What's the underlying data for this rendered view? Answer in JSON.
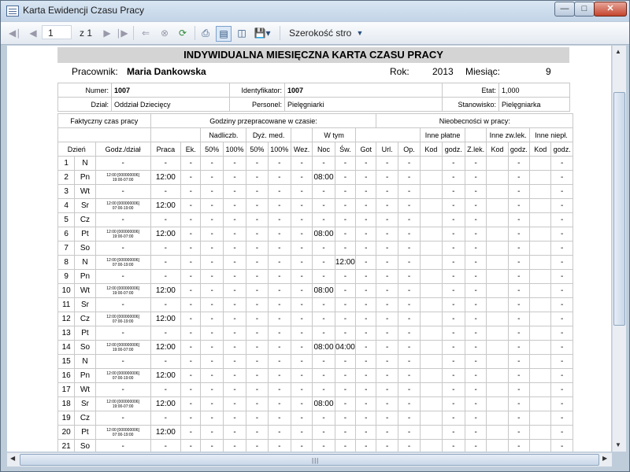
{
  "window": {
    "title": "Karta Ewidencji Czasu Pracy"
  },
  "toolbar": {
    "page_current": "1",
    "page_of": "z 1",
    "zoom_mode": "Szerokość stro"
  },
  "doc": {
    "title": "INDYWIDUALNA MIESIĘCZNA KARTA CZASU PRACY",
    "employee_label": "Pracownik:",
    "employee": "Maria Dankowska",
    "year_label": "Rok:",
    "year": "2013",
    "month_label": "Miesiąc:",
    "month": "9",
    "info": {
      "numer_label": "Numer:",
      "numer": "1007",
      "identyfikator_label": "Identyfikator:",
      "identyfikator": "1007",
      "etat_label": "Etat:",
      "etat": "1,000",
      "dzial_label": "Dział:",
      "dzial": "Oddział Dziecięcy",
      "personel_label": "Personel:",
      "personel": "Pielęgniarki",
      "stanowisko_label": "Stanowisko:",
      "stanowisko": "Pielęgniarka"
    },
    "headers": {
      "faktyczny": "Faktyczny czas pracy",
      "godziny": "Godziny przepracowane w czasie:",
      "nieobecnosci": "Nieobecności w pracy:",
      "nadliczb": "Nadliczb.",
      "dyz_med": "Dyż. med.",
      "w_tym": "W tym",
      "inne_platne": "Inne płatne",
      "inne_zw_lek": "Inne zw.lek.",
      "inne_niepl": "Inne niepł.",
      "cols": [
        "Dzień",
        "Godz./dział",
        "Praca",
        "Ek.",
        "50%",
        "100%",
        "50%",
        "100%",
        "Wez.",
        "Noc",
        "Św.",
        "Got",
        "Url.",
        "Op.",
        "Kod",
        "godz.",
        "Z.lek.",
        "Kod",
        "godz.",
        "Kod",
        "godz."
      ]
    },
    "rows": [
      {
        "day": "1",
        "dow": "N",
        "gd": "-",
        "praca": "-",
        "noc": "-",
        "sw": "-"
      },
      {
        "day": "2",
        "dow": "Pn",
        "gd": "12:00 [000000006]\n19:00-07:00",
        "praca": "12:00",
        "noc": "08:00",
        "sw": "-"
      },
      {
        "day": "3",
        "dow": "Wt",
        "gd": "-",
        "praca": "-",
        "noc": "-",
        "sw": "-"
      },
      {
        "day": "4",
        "dow": "Sr",
        "gd": "12:00 [000000006]\n07:00-19:00",
        "praca": "12:00",
        "noc": "-",
        "sw": "-"
      },
      {
        "day": "5",
        "dow": "Cz",
        "gd": "-",
        "praca": "-",
        "noc": "-",
        "sw": "-"
      },
      {
        "day": "6",
        "dow": "Pt",
        "gd": "12:00 [000000006]\n19:00-07:00",
        "praca": "12:00",
        "noc": "08:00",
        "sw": "-"
      },
      {
        "day": "7",
        "dow": "So",
        "gd": "-",
        "praca": "-",
        "noc": "-",
        "sw": "-"
      },
      {
        "day": "8",
        "dow": "N",
        "gd": "12:00 [000000006]\n07:00-19:00",
        "praca": "-",
        "noc": "-",
        "sw": "12:00"
      },
      {
        "day": "9",
        "dow": "Pn",
        "gd": "-",
        "praca": "-",
        "noc": "-",
        "sw": "-"
      },
      {
        "day": "10",
        "dow": "Wt",
        "gd": "12:00 [000000006]\n19:00-07:00",
        "praca": "12:00",
        "noc": "08:00",
        "sw": "-"
      },
      {
        "day": "11",
        "dow": "Sr",
        "gd": "-",
        "praca": "-",
        "noc": "-",
        "sw": "-"
      },
      {
        "day": "12",
        "dow": "Cz",
        "gd": "12:00 [000000006]\n07:00-19:00",
        "praca": "12:00",
        "noc": "-",
        "sw": "-"
      },
      {
        "day": "13",
        "dow": "Pt",
        "gd": "-",
        "praca": "-",
        "noc": "-",
        "sw": "-"
      },
      {
        "day": "14",
        "dow": "So",
        "gd": "12:00 [000000006]\n19:00-07:00",
        "praca": "12:00",
        "noc": "08:00",
        "sw": "04:00"
      },
      {
        "day": "15",
        "dow": "N",
        "gd": "-",
        "praca": "-",
        "noc": "-",
        "sw": "-"
      },
      {
        "day": "16",
        "dow": "Pn",
        "gd": "12:00 [000000006]\n07:00-19:00",
        "praca": "12:00",
        "noc": "-",
        "sw": "-"
      },
      {
        "day": "17",
        "dow": "Wt",
        "gd": "-",
        "praca": "-",
        "noc": "-",
        "sw": "-"
      },
      {
        "day": "18",
        "dow": "Sr",
        "gd": "12:00 [000000006]\n19:00-07:00",
        "praca": "12:00",
        "noc": "08:00",
        "sw": "-"
      },
      {
        "day": "19",
        "dow": "Cz",
        "gd": "-",
        "praca": "-",
        "noc": "-",
        "sw": "-"
      },
      {
        "day": "20",
        "dow": "Pt",
        "gd": "12:00 [000000006]\n07:00-19:00",
        "praca": "12:00",
        "noc": "-",
        "sw": "-"
      },
      {
        "day": "21",
        "dow": "So",
        "gd": "-",
        "praca": "-",
        "noc": "-",
        "sw": "-"
      }
    ]
  }
}
